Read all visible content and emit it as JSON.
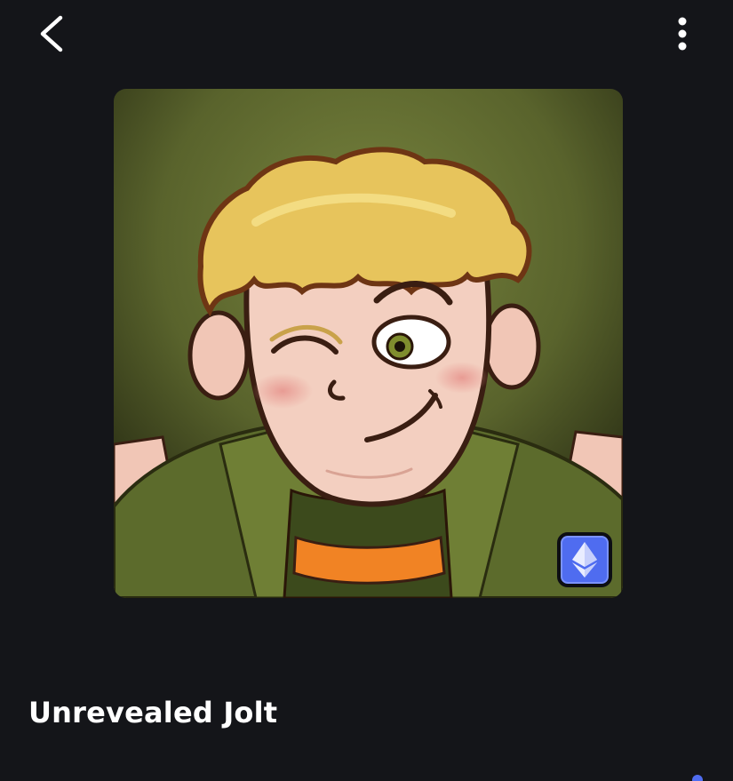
{
  "header": {
    "back_icon": "chevron-left-icon",
    "more_icon": "vertical-dots-icon"
  },
  "nft": {
    "image_subject": "cartoon-winking-blond-boy",
    "chain_icon": "ethereum-icon",
    "chain_badge_color": "#4f6cf0",
    "title": "Unrevealed Jolt"
  },
  "colors": {
    "background": "#141519",
    "text": "#ffffff",
    "accent": "#4f6cf0"
  }
}
